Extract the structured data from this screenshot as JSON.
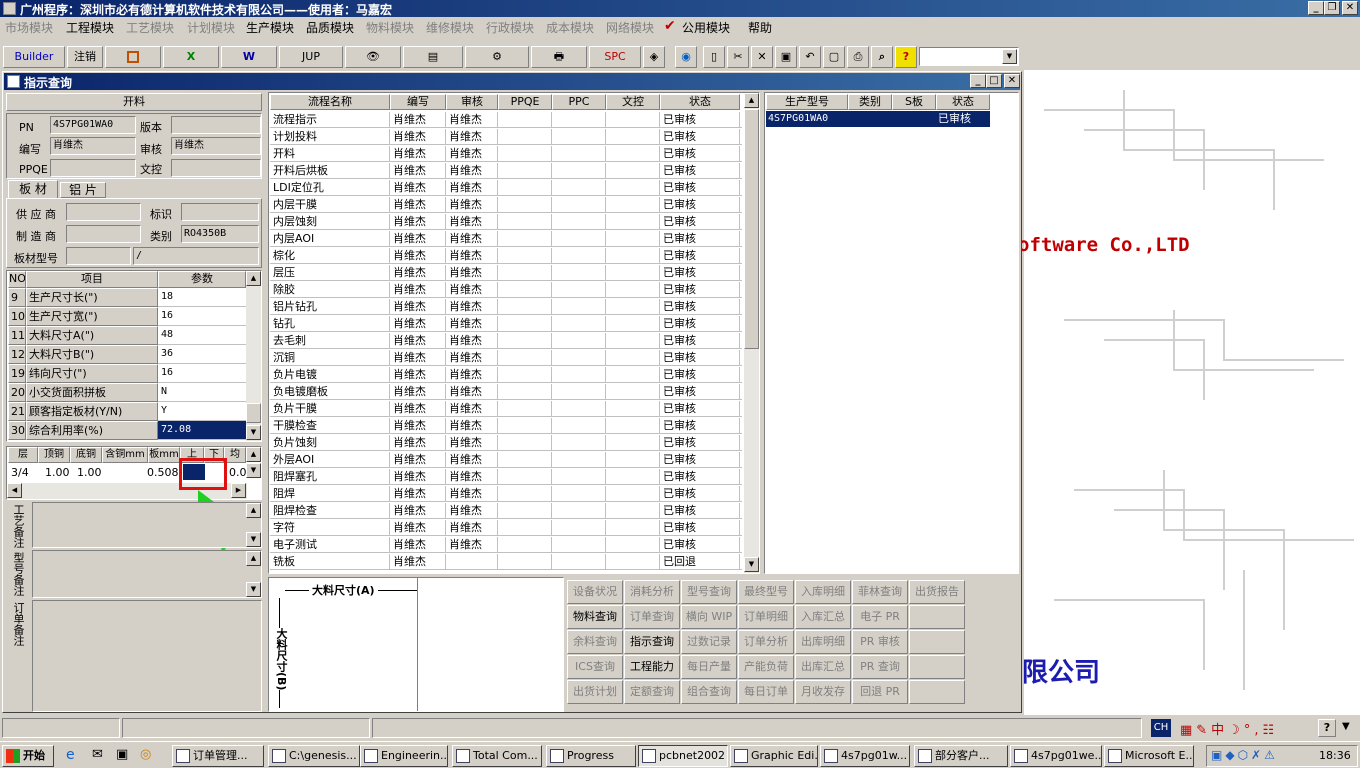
{
  "app": {
    "title": "广州程序：深圳市必有德计算机软件技术有限公司——使用者：马嘉宏"
  },
  "menu": [
    {
      "label": "市场模块",
      "enabled": false
    },
    {
      "label": "工程模块",
      "enabled": true
    },
    {
      "label": "工艺模块",
      "enabled": false
    },
    {
      "label": "计划模块",
      "enabled": false
    },
    {
      "label": "生产模块",
      "enabled": true
    },
    {
      "label": "品质模块",
      "enabled": true
    },
    {
      "label": "物料模块",
      "enabled": false
    },
    {
      "label": "维修模块",
      "enabled": false
    },
    {
      "label": "行政模块",
      "enabled": false
    },
    {
      "label": "成本模块",
      "enabled": false
    },
    {
      "label": "网络模块",
      "enabled": false
    },
    {
      "label": "公用模块",
      "enabled": true
    },
    {
      "label": "帮助",
      "enabled": true
    }
  ],
  "toolbar": {
    "builder": "Builder",
    "logout": "注销",
    "jup": "JUP",
    "spc": "SPC"
  },
  "background": {
    "tagline": "oftware Co.,LTD",
    "company_fragment": "限公司"
  },
  "window": {
    "title": "指示查询"
  },
  "left": {
    "section_title": "开料",
    "pn_label": "PN",
    "pn_value": "4S7PG01WA0",
    "version_label": "版本",
    "version_value": "",
    "author_label": "编写",
    "author_value": "肖维杰",
    "review_label": "审核",
    "review_value": "肖维杰",
    "ppqe_label": "PPQE",
    "ppqe_value": "",
    "doc_label": "文控",
    "doc_value": "",
    "tab_board": "板 材",
    "tab_al": "铝 片",
    "supplier_label": "供 应 商",
    "supplier_value": "",
    "mark_label": "标识",
    "mark_value": "",
    "maker_label": "制 造 商",
    "maker_value": "",
    "category_label": "类别",
    "category_value": "RO4350B",
    "model_label": "板材型号",
    "model_value": "",
    "model_value2": "/",
    "param_headers": [
      "NO",
      "项目",
      "参数"
    ],
    "params": [
      {
        "no": "9",
        "item": "生产尺寸长(\")",
        "value": "18"
      },
      {
        "no": "10",
        "item": "生产尺寸宽(\")",
        "value": "16"
      },
      {
        "no": "11",
        "item": "大料尺寸A(\")",
        "value": "48"
      },
      {
        "no": "12",
        "item": "大料尺寸B(\")",
        "value": "36"
      },
      {
        "no": "19",
        "item": "纬向尺寸(\")",
        "value": "16"
      },
      {
        "no": "20",
        "item": "小交货面积拼板",
        "value": "N"
      },
      {
        "no": "21",
        "item": "顾客指定板材(Y/N)",
        "value": "Y"
      },
      {
        "no": "30",
        "item": "综合利用率(%)",
        "value": "72.08"
      }
    ],
    "layer_headers": [
      "层",
      "顶铜",
      "底铜",
      "含铜mm",
      "板mm",
      "上",
      "下",
      "均"
    ],
    "layer_row": {
      "layer": "3/4",
      "top": "1.00",
      "bottom": "1.00",
      "cu": "",
      "board": "0.508",
      "up": "",
      "down": "",
      "avg": "0.0"
    },
    "notes": [
      "工艺备注",
      "型号备注",
      "订单备注"
    ]
  },
  "flow": {
    "headers": [
      "流程名称",
      "编写",
      "审核",
      "PPQE",
      "PPC",
      "文控",
      "状态"
    ],
    "rows": [
      {
        "name": "流程指示",
        "author": "肖维杰",
        "review": "肖维杰",
        "status": "已审核"
      },
      {
        "name": "计划投料",
        "author": "肖维杰",
        "review": "肖维杰",
        "status": "已审核"
      },
      {
        "name": "开料",
        "author": "肖维杰",
        "review": "肖维杰",
        "status": "已审核"
      },
      {
        "name": "开料后烘板",
        "author": "肖维杰",
        "review": "肖维杰",
        "status": "已审核"
      },
      {
        "name": "LDI定位孔",
        "author": "肖维杰",
        "review": "肖维杰",
        "status": "已审核"
      },
      {
        "name": "内层干膜",
        "author": "肖维杰",
        "review": "肖维杰",
        "status": "已审核"
      },
      {
        "name": "内层蚀刻",
        "author": "肖维杰",
        "review": "肖维杰",
        "status": "已审核"
      },
      {
        "name": "内层AOI",
        "author": "肖维杰",
        "review": "肖维杰",
        "status": "已审核"
      },
      {
        "name": "棕化",
        "author": "肖维杰",
        "review": "肖维杰",
        "status": "已审核"
      },
      {
        "name": "层压",
        "author": "肖维杰",
        "review": "肖维杰",
        "status": "已审核"
      },
      {
        "name": "除胶",
        "author": "肖维杰",
        "review": "肖维杰",
        "status": "已审核"
      },
      {
        "name": "铝片钻孔",
        "author": "肖维杰",
        "review": "肖维杰",
        "status": "已审核"
      },
      {
        "name": "钻孔",
        "author": "肖维杰",
        "review": "肖维杰",
        "status": "已审核"
      },
      {
        "name": "去毛刺",
        "author": "肖维杰",
        "review": "肖维杰",
        "status": "已审核"
      },
      {
        "name": "沉铜",
        "author": "肖维杰",
        "review": "肖维杰",
        "status": "已审核"
      },
      {
        "name": "负片电镀",
        "author": "肖维杰",
        "review": "肖维杰",
        "status": "已审核"
      },
      {
        "name": "负电镀磨板",
        "author": "肖维杰",
        "review": "肖维杰",
        "status": "已审核"
      },
      {
        "name": "负片干膜",
        "author": "肖维杰",
        "review": "肖维杰",
        "status": "已审核"
      },
      {
        "name": "干膜检查",
        "author": "肖维杰",
        "review": "肖维杰",
        "status": "已审核"
      },
      {
        "name": "负片蚀刻",
        "author": "肖维杰",
        "review": "肖维杰",
        "status": "已审核"
      },
      {
        "name": "外层AOI",
        "author": "肖维杰",
        "review": "肖维杰",
        "status": "已审核"
      },
      {
        "name": "阻焊塞孔",
        "author": "肖维杰",
        "review": "肖维杰",
        "status": "已审核"
      },
      {
        "name": "阻焊",
        "author": "肖维杰",
        "review": "肖维杰",
        "status": "已审核"
      },
      {
        "name": "阻焊检查",
        "author": "肖维杰",
        "review": "肖维杰",
        "status": "已审核"
      },
      {
        "name": "字符",
        "author": "肖维杰",
        "review": "肖维杰",
        "status": "已审核"
      },
      {
        "name": "电子测试",
        "author": "肖维杰",
        "review": "肖维杰",
        "status": "已审核"
      },
      {
        "name": "铣板",
        "author": "肖维杰",
        "review": "",
        "status": "已回退"
      }
    ]
  },
  "model_grid": {
    "headers": [
      "生产型号",
      "类别",
      "S板",
      "状态"
    ],
    "rows": [
      {
        "model": "4S7PG01WA0",
        "type": "",
        "s": "",
        "status": "已审核"
      }
    ]
  },
  "diagram": {
    "a_label": "大料尺寸(A)",
    "b_label": "大料尺寸(B)"
  },
  "queries": [
    {
      "label": "设备状况",
      "enabled": false
    },
    {
      "label": "消耗分析",
      "enabled": false
    },
    {
      "label": "型号查询",
      "enabled": false
    },
    {
      "label": "最终型号",
      "enabled": false
    },
    {
      "label": "入库明细",
      "enabled": false
    },
    {
      "label": "菲林查询",
      "enabled": false
    },
    {
      "label": "出货报告",
      "enabled": false
    },
    {
      "label": "物料查询",
      "enabled": true
    },
    {
      "label": "订单查询",
      "enabled": false
    },
    {
      "label": "横向 WIP",
      "enabled": false
    },
    {
      "label": "订单明细",
      "enabled": false
    },
    {
      "label": "入库汇总",
      "enabled": false
    },
    {
      "label": "电子 PR",
      "enabled": false
    },
    {
      "label": "",
      "enabled": false
    },
    {
      "label": "余料查询",
      "enabled": false
    },
    {
      "label": "指示查询",
      "enabled": true
    },
    {
      "label": "过数记录",
      "enabled": false
    },
    {
      "label": "订单分析",
      "enabled": false
    },
    {
      "label": "出库明细",
      "enabled": false
    },
    {
      "label": "PR 审核",
      "enabled": false
    },
    {
      "label": "",
      "enabled": false
    },
    {
      "label": "ICS查询",
      "enabled": false
    },
    {
      "label": "工程能力",
      "enabled": true
    },
    {
      "label": "每日产量",
      "enabled": false
    },
    {
      "label": "产能负荷",
      "enabled": false
    },
    {
      "label": "出库汇总",
      "enabled": false
    },
    {
      "label": "PR 查询",
      "enabled": false
    },
    {
      "label": "",
      "enabled": false
    },
    {
      "label": "出货计划",
      "enabled": false
    },
    {
      "label": "定额查询",
      "enabled": false
    },
    {
      "label": "组合查询",
      "enabled": false
    },
    {
      "label": "每日订单",
      "enabled": false
    },
    {
      "label": "月收发存",
      "enabled": false
    },
    {
      "label": "回退 PR",
      "enabled": false
    },
    {
      "label": "",
      "enabled": false
    }
  ],
  "tray": {
    "ime": "CH",
    "time": "18:36"
  },
  "taskbar": {
    "start": "开始",
    "tasks": [
      "订单管理...",
      "C:\\genesis...",
      "Engineerin...",
      "Total Com...",
      "Progress",
      "pcbnet2002",
      "Graphic Edi...",
      "4s7pg01w...",
      "部分客户...",
      "4s7pg01we...",
      "Microsoft E..."
    ],
    "active_index": 5
  }
}
